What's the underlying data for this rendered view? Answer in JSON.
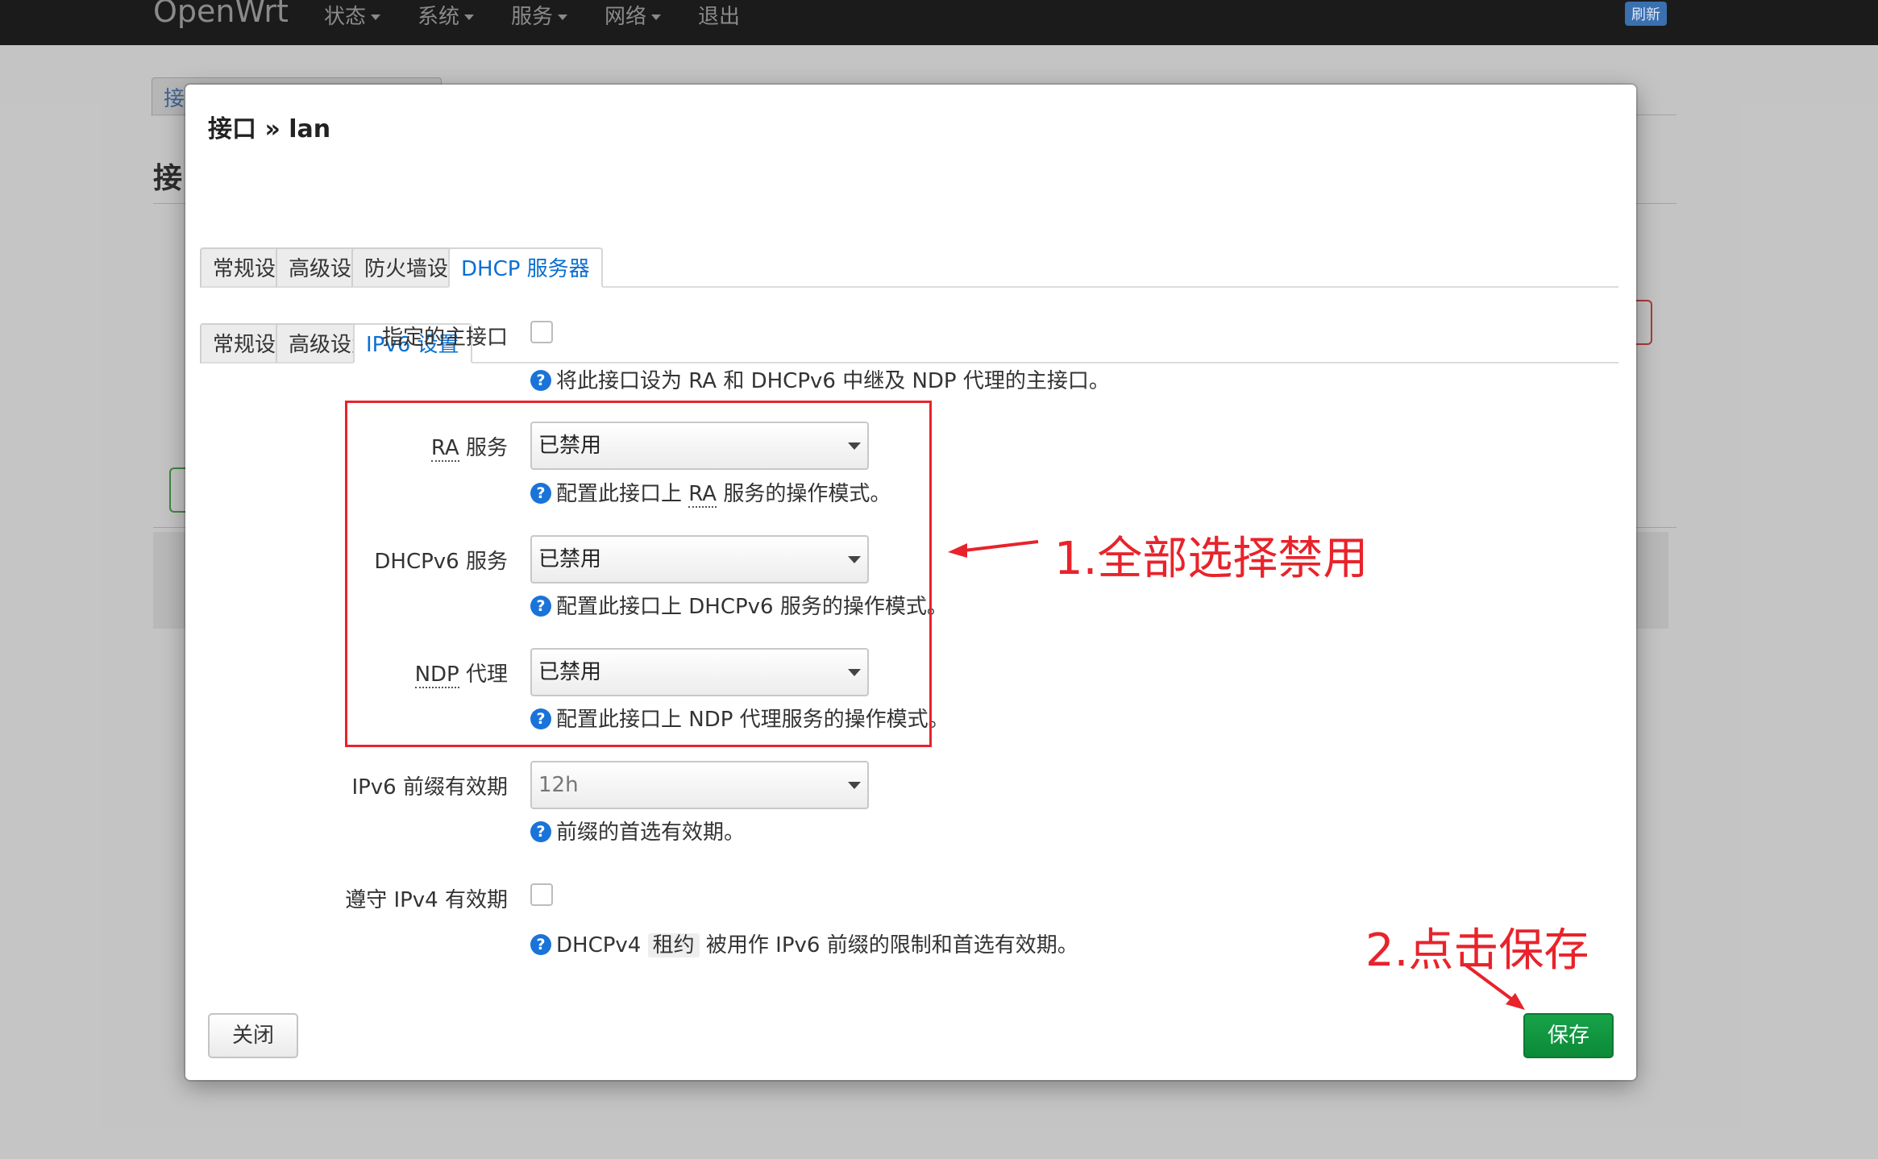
{
  "topbar": {
    "brand": "OpenWrt",
    "menu": [
      "状态",
      "系统",
      "服务",
      "网络"
    ],
    "logout": "退出",
    "refresh": "刷新"
  },
  "background": {
    "tab_fragment": "接",
    "heading_fragment": "接"
  },
  "modal": {
    "title": "接口 » lan",
    "main_tabs": [
      "常规设置",
      "高级设置",
      "防火墙设置",
      "DHCP 服务器"
    ],
    "main_active": "DHCP 服务器",
    "sub_tabs": [
      "常规设置",
      "高级设置",
      "IPv6 设置"
    ],
    "sub_active": "IPv6 设置",
    "fields": {
      "master": {
        "label": "指定的主接口",
        "checked": false,
        "help": "将此接口设为 RA 和 DHCPv6 中继及 NDP 代理的主接口。"
      },
      "ra": {
        "label_abbr": "RA",
        "label_rest": " 服务",
        "value": "已禁用",
        "help_pre": "配置此接口上 ",
        "help_abbr": "RA",
        "help_post": " 服务的操作模式。"
      },
      "dhcpv6": {
        "label": "DHCPv6 服务",
        "value": "已禁用",
        "help": "配置此接口上 DHCPv6 服务的操作模式。"
      },
      "ndp": {
        "label_abbr": "NDP",
        "label_rest": " 代理",
        "value": "已禁用",
        "help": "配置此接口上 NDP 代理服务的操作模式。"
      },
      "prefix_lifetime": {
        "label": "IPv6 前缀有效期",
        "value": "12h",
        "help": "前缀的首选有效期。"
      },
      "ipv4_lifetime": {
        "label": "遵守 IPv4 有效期",
        "checked": false,
        "help_pre": "DHCPv4 ",
        "help_code": "租约",
        "help_post": " 被用作 IPv6 前缀的限制和首选有效期。"
      }
    },
    "close_label": "关闭",
    "save_label": "保存"
  },
  "annotations": {
    "step1": "1.全部选择禁用",
    "step2": "2.点击保存",
    "color": "#e8232b"
  },
  "colors": {
    "accent": "#0b6fd0",
    "save_button": "#0c8a37",
    "help_icon": "#1a73d8"
  }
}
